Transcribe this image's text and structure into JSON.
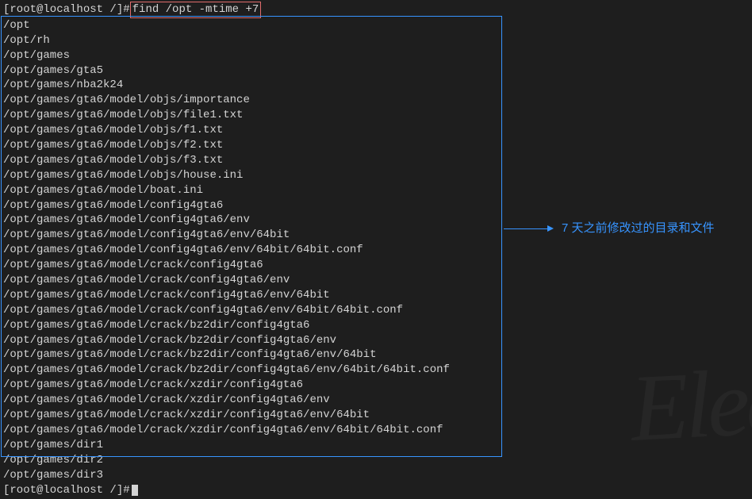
{
  "prompt1": {
    "prefix": "[root@localhost /]# ",
    "command": "find /opt -mtime +7"
  },
  "output": [
    "/opt",
    "/opt/rh",
    "/opt/games",
    "/opt/games/gta5",
    "/opt/games/nba2k24",
    "/opt/games/gta6/model/objs/importance",
    "/opt/games/gta6/model/objs/file1.txt",
    "/opt/games/gta6/model/objs/f1.txt",
    "/opt/games/gta6/model/objs/f2.txt",
    "/opt/games/gta6/model/objs/f3.txt",
    "/opt/games/gta6/model/objs/house.ini",
    "/opt/games/gta6/model/boat.ini",
    "/opt/games/gta6/model/config4gta6",
    "/opt/games/gta6/model/config4gta6/env",
    "/opt/games/gta6/model/config4gta6/env/64bit",
    "/opt/games/gta6/model/config4gta6/env/64bit/64bit.conf",
    "/opt/games/gta6/model/crack/config4gta6",
    "/opt/games/gta6/model/crack/config4gta6/env",
    "/opt/games/gta6/model/crack/config4gta6/env/64bit",
    "/opt/games/gta6/model/crack/config4gta6/env/64bit/64bit.conf",
    "/opt/games/gta6/model/crack/bz2dir/config4gta6",
    "/opt/games/gta6/model/crack/bz2dir/config4gta6/env",
    "/opt/games/gta6/model/crack/bz2dir/config4gta6/env/64bit",
    "/opt/games/gta6/model/crack/bz2dir/config4gta6/env/64bit/64bit.conf",
    "/opt/games/gta6/model/crack/xzdir/config4gta6",
    "/opt/games/gta6/model/crack/xzdir/config4gta6/env",
    "/opt/games/gta6/model/crack/xzdir/config4gta6/env/64bit",
    "/opt/games/gta6/model/crack/xzdir/config4gta6/env/64bit/64bit.conf",
    "/opt/games/dir1",
    "/opt/games/dir2",
    "/opt/games/dir3"
  ],
  "prompt2": {
    "prefix": "[root@localhost /]# "
  },
  "annotation": "7 天之前修改过的目录和文件",
  "watermark": "Elec"
}
